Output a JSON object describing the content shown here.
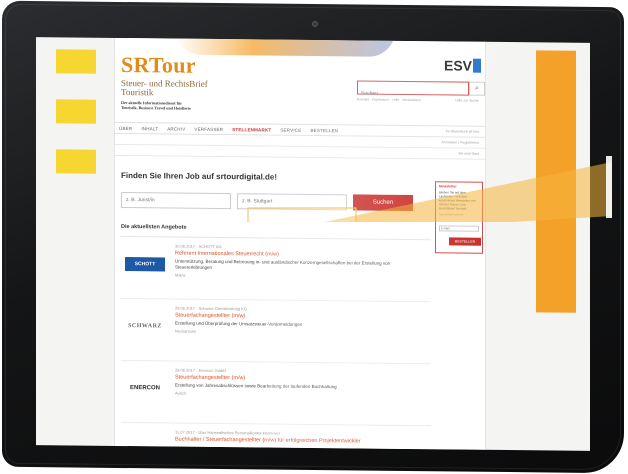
{
  "site": {
    "logo_text": "SRTour",
    "subtitle_line1": "Steuer- und RechtsBrief",
    "subtitle_line2": "Touristik",
    "tagline_line1": "Der aktuelle Informationsdienst für",
    "tagline_line2": "Touristik, Business Travel und Hotellerie",
    "publisher_logo": "ESV"
  },
  "header": {
    "search_placeholder": "Suchen",
    "search_icon": "search-icon",
    "toplinks": "Kontakt · Impressum · Hilfe · Mediadaten",
    "print_link": "Hilfe zur Suche"
  },
  "nav": {
    "items": [
      {
        "label": "ÜBER"
      },
      {
        "label": "INHALT"
      },
      {
        "label": "ARCHIV"
      },
      {
        "label": "VERFASSER"
      },
      {
        "label": "STELLENMARKT"
      },
      {
        "label": "SERVICE"
      },
      {
        "label": "BESTELLEN"
      }
    ],
    "active_label": "STELLENMARKT",
    "right_text": "Ihr Warenkorb ist leer",
    "subrow1": "Anmelden | Registrieren",
    "subrow2": "Sie sind Gast"
  },
  "jobsearch": {
    "heading": "Finden Sie Ihren Job auf srtourdigital.de!",
    "jobs_placeholder": "z. B. Jurist/in",
    "location_placeholder": "z. B. Stuttgart",
    "button": "Suchen",
    "offers_heading": "Die aktuellsten Angebote"
  },
  "jobs": [
    {
      "meta": "30.06.2017 · SCHOTT AG",
      "title": "Referent Internationales Steuerrecht (m/w)",
      "desc": "Unterstützung, Beratung und Betreuung in- und ausländischer Konzerngesellschaften bei der Erstellung von Steuererklärungen",
      "location": "Mainz",
      "logo": "SCHOTT"
    },
    {
      "meta": "29.06.2017 · Schwarz Dienstleistung KG",
      "title": "Steuerfachangestellter (m/w)",
      "desc": "Erstellung und Überprüfung der Umsatzsteuer-Voranmeldungen",
      "location": "Neckarsulm",
      "logo": "SCHWARZ"
    },
    {
      "meta": "29.06.2017 · Enercon GmbH",
      "title": "Steuerfachangestellter (m/w)",
      "desc": "Erstellung von Jahresabschlüssen sowie Bearbeitung der laufenden Buchhaltung",
      "location": "Aurich",
      "logo": "ENERCON"
    },
    {
      "meta": "11.07.2017 · über Hanseatisches Personalkontor Hannover",
      "title": "Buchhalter / Steuerfachangestellter (m/w) für erfolgreichen Projektentwickler",
      "desc": "",
      "location": "",
      "logo": ""
    }
  ],
  "newsletter": {
    "title": "Newsletter",
    "text": "Bleiben Sie auf dem Laufenden – mit dem kostenlosen Newsletter von SRTour Steuer- und RechtsBrief Touristik",
    "small": "Ihre E-Mail-Adresse",
    "input_placeholder": "E-Mail",
    "button": "BESTELLEN"
  },
  "colors": {
    "accent_orange": "#e38a17",
    "accent_red": "#c9302c",
    "deco_yellow": "#f6d731",
    "deco_orange": "#f4a12a"
  }
}
